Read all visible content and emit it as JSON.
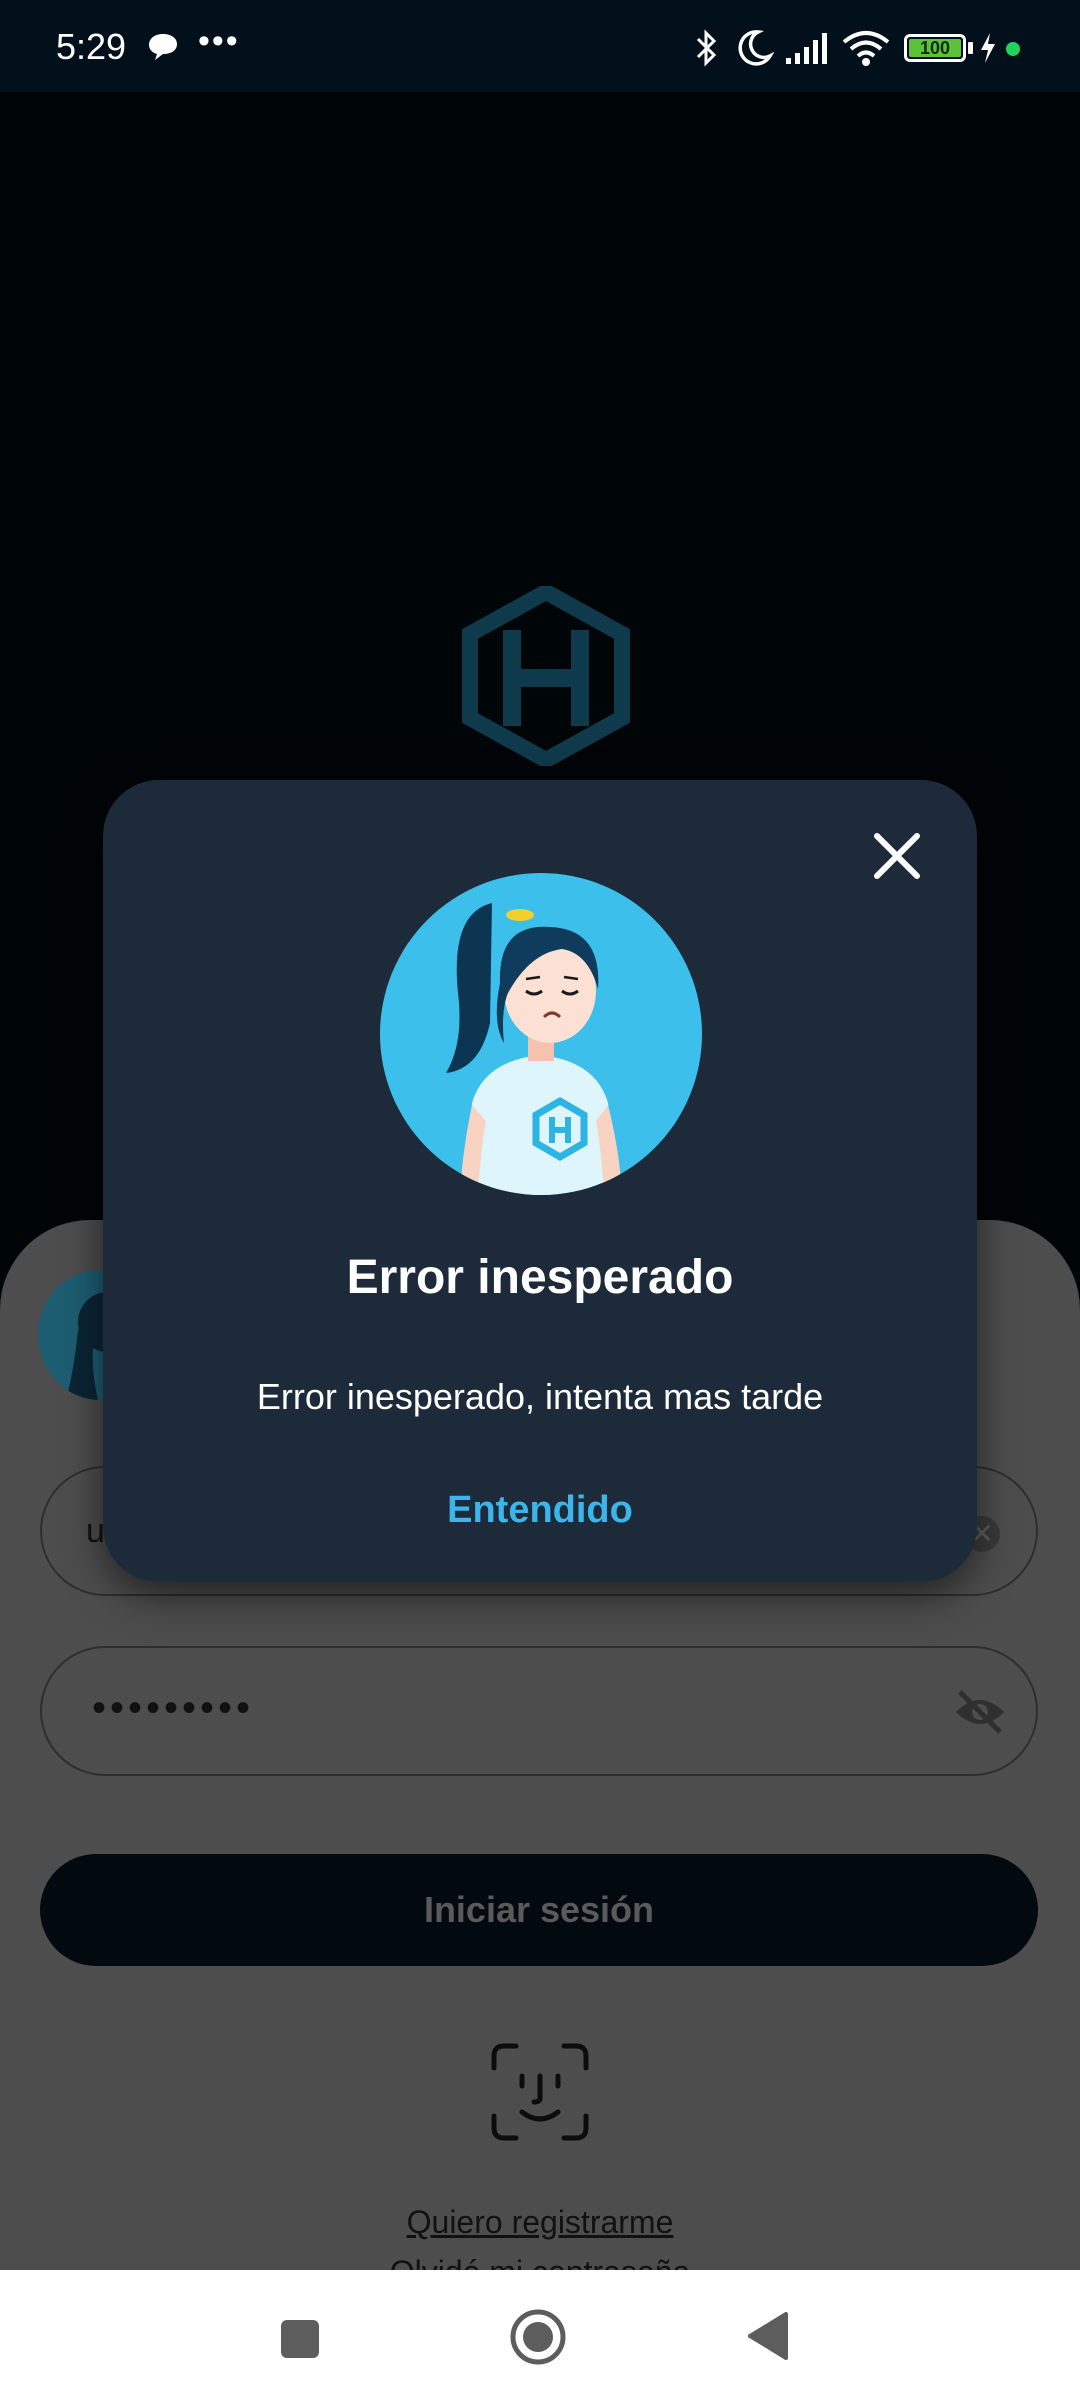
{
  "status_bar": {
    "time": "5:29",
    "battery_level": "100",
    "icons": [
      "chat-icon",
      "more-dots-icon",
      "bluetooth-icon",
      "moon-icon",
      "signal-icon",
      "wifi-icon",
      "battery-icon",
      "charging-icon"
    ]
  },
  "login": {
    "username_value": "u",
    "password_value": "•••••••••",
    "login_button": "Iniciar sesión",
    "register_link": "Quiero registrarme",
    "forgot_link": "Olvidé mi contraseña"
  },
  "dialog": {
    "title": "Error inesperado",
    "message": "Error inesperado, intenta mas tarde",
    "confirm_button": "Entendido"
  },
  "colors": {
    "dialog_bg": "#1c2a3a",
    "accent": "#3cb5ea",
    "illustration_bg": "#3dbfeb",
    "logo": "#0f3a4c"
  }
}
